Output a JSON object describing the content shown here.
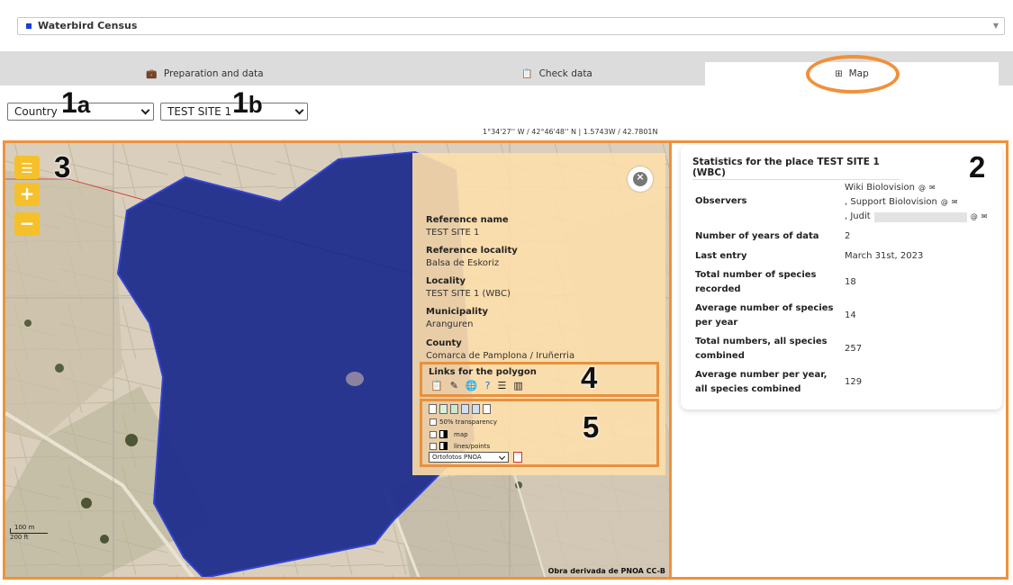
{
  "app": {
    "title": "Waterbird Census"
  },
  "tabs": [
    {
      "label": "Preparation and data",
      "icon": "briefcase-icon"
    },
    {
      "label": "Check data",
      "icon": "clipboard-check-icon"
    },
    {
      "label": "Map",
      "icon": "grid-icon",
      "active": true
    }
  ],
  "filters": {
    "country": {
      "value": "Country"
    },
    "site": {
      "value": "TEST SITE 1"
    }
  },
  "coords": "1°34'27'' W / 42°46'48'' N | 1.5743W / 42.7801N",
  "annotations": {
    "n1a": "1",
    "n1a_s": "a",
    "n1b": "1",
    "n1b_s": "b",
    "n2": "2",
    "n3": "3",
    "n4": "4",
    "n5": "5"
  },
  "map": {
    "zoom_in": "+",
    "zoom_out": "−",
    "scale_m": "100 m",
    "scale_ft": "200 ft",
    "attribution": "Obra derivada de PNOA CC-B",
    "colors": {
      "polygon_fill": "#1a2a8c",
      "polygon_stroke": "#2438d8",
      "accent": "#f0913a"
    }
  },
  "popup": {
    "fields": [
      {
        "label": "Reference name",
        "value": "TEST SITE 1"
      },
      {
        "label": "Reference locality",
        "value": "Balsa de Eskoriz"
      },
      {
        "label": "Locality",
        "value": "TEST SITE 1 (WBC)"
      },
      {
        "label": "Municipality",
        "value": "Aranguren"
      },
      {
        "label": "County",
        "value": "Comarca de Pamplona / Iruñerria"
      }
    ],
    "links_title": "Links for the polygon",
    "tools": {
      "transparency": "50% transparency",
      "map": "map",
      "lines": "lines/points",
      "basemap": "Ortofotos PNOA"
    }
  },
  "stats": {
    "title": "Statistics for the place TEST SITE 1 (WBC)",
    "observers_label": "Observers",
    "observers": [
      "Wiki Biolovision",
      ", Support Biolovision",
      ", Judit"
    ],
    "rows": [
      {
        "label": "Number of years of data",
        "value": "2"
      },
      {
        "label": "Last entry",
        "value": "March 31st, 2023"
      },
      {
        "label": "Total number of species recorded",
        "value": "18"
      },
      {
        "label": "Average number of species per year",
        "value": "14"
      },
      {
        "label": "Total numbers, all species combined",
        "value": "257"
      },
      {
        "label": "Average number per year, all species combined",
        "value": "129"
      }
    ]
  }
}
